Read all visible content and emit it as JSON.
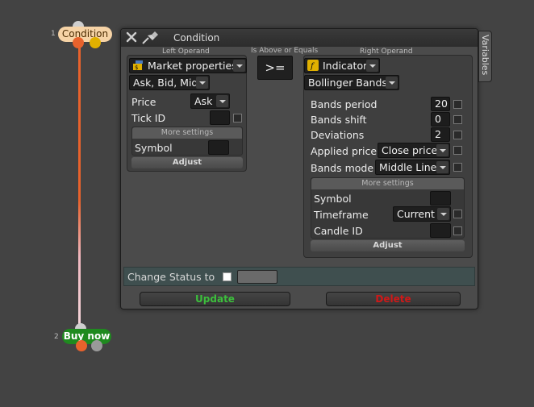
{
  "nodes": {
    "condition": {
      "number": "1",
      "label": "Condition"
    },
    "buy_now": {
      "number": "2",
      "label": "Buy now"
    }
  },
  "dialog": {
    "title": "Condition",
    "variables_tab": "Variables",
    "left_operand_label": "Left Operand",
    "operator_label": "Is Above or Equals",
    "right_operand_label": "Right Operand",
    "operator": ">=",
    "left": {
      "type": "Market properties",
      "property": "Ask, Bid, Mid",
      "price_label": "Price",
      "price_value": "Ask",
      "tick_id_label": "Tick ID",
      "tick_id_value": "",
      "more_settings": "More settings",
      "symbol_label": "Symbol",
      "symbol_value": "",
      "adjust": "Adjust"
    },
    "right": {
      "type": "Indicator",
      "indicator": "Bollinger Bands",
      "bands_period_label": "Bands period",
      "bands_period_value": "20",
      "bands_shift_label": "Bands shift",
      "bands_shift_value": "0",
      "deviations_label": "Deviations",
      "deviations_value": "2",
      "applied_price_label": "Applied price",
      "applied_price_value": "Close price",
      "bands_mode_label": "Bands mode",
      "bands_mode_value": "Middle Line",
      "more_settings": "More settings",
      "symbol_label": "Symbol",
      "symbol_value": "",
      "timeframe_label": "Timeframe",
      "timeframe_value": "Current",
      "candle_id_label": "Candle ID",
      "candle_id_value": "",
      "adjust": "Adjust"
    },
    "change_status_label": "Change Status to",
    "change_status_value": "",
    "update_button": "Update",
    "delete_button": "Delete"
  },
  "colors": {
    "background": "#434343",
    "wire": "#e8622c",
    "update": "#3cbf3c",
    "delete": "#d01818",
    "condition_pill": "#f6d3a6",
    "buy_pill": "#1f8a1f"
  }
}
